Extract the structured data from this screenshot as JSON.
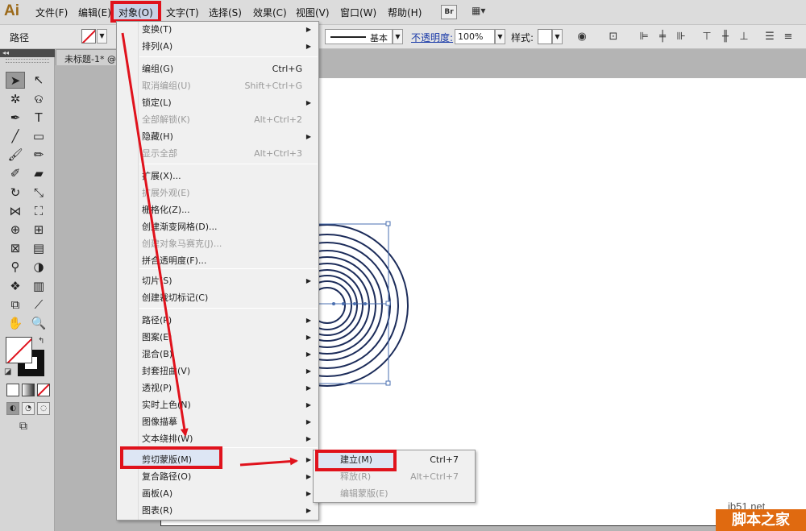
{
  "app": {
    "logo": "Ai"
  },
  "menubar": {
    "items": [
      "文件(F)",
      "编辑(E)",
      "对象(O)",
      "文字(T)",
      "选择(S)",
      "效果(C)",
      "视图(V)",
      "窗口(W)",
      "帮助(H)"
    ],
    "bridge_label": "Br",
    "arrange_icon": "▦▾"
  },
  "controlbar": {
    "selection_label": "路径",
    "stroke_profile": "基本",
    "opacity_label": "不透明度:",
    "opacity_value": "100%",
    "style_label": "样式:"
  },
  "document": {
    "tab_title": "未标题-1* @"
  },
  "object_menu": {
    "items": [
      {
        "label": "变换(T)",
        "submenu": true
      },
      {
        "label": "排列(A)",
        "submenu": true
      },
      {
        "label": "编组(G)",
        "shortcut": "Ctrl+G"
      },
      {
        "label": "取消编组(U)",
        "shortcut": "Shift+Ctrl+G",
        "disabled": true
      },
      {
        "label": "锁定(L)",
        "submenu": true
      },
      {
        "label": "全部解锁(K)",
        "shortcut": "Alt+Ctrl+2",
        "disabled": true
      },
      {
        "label": "隐藏(H)",
        "submenu": true
      },
      {
        "label": "显示全部",
        "shortcut": "Alt+Ctrl+3",
        "disabled": true
      },
      {
        "label": "扩展(X)..."
      },
      {
        "label": "扩展外观(E)",
        "disabled": true
      },
      {
        "label": "栅格化(Z)..."
      },
      {
        "label": "创建渐变网格(D)..."
      },
      {
        "label": "创建对象马赛克(J)...",
        "disabled": true
      },
      {
        "label": "拼合透明度(F)..."
      },
      {
        "label": "切片(S)",
        "submenu": true
      },
      {
        "label": "创建裁切标记(C)"
      },
      {
        "label": "路径(P)",
        "submenu": true
      },
      {
        "label": "图案(E)",
        "submenu": true
      },
      {
        "label": "混合(B)",
        "submenu": true
      },
      {
        "label": "封套扭曲(V)",
        "submenu": true
      },
      {
        "label": "透视(P)",
        "submenu": true
      },
      {
        "label": "实时上色(N)",
        "submenu": true
      },
      {
        "label": "图像描摹",
        "submenu": true
      },
      {
        "label": "文本绕排(W)",
        "submenu": true
      },
      {
        "label": "剪切蒙版(M)",
        "submenu": true,
        "highlighted": true
      },
      {
        "label": "复合路径(O)",
        "submenu": true
      },
      {
        "label": "画板(A)",
        "submenu": true
      },
      {
        "label": "图表(R)",
        "submenu": true
      }
    ]
  },
  "clip_submenu": {
    "items": [
      {
        "label": "建立(M)",
        "shortcut": "Ctrl+7",
        "highlighted": true
      },
      {
        "label": "释放(R)",
        "shortcut": "Alt+Ctrl+7",
        "disabled": true
      },
      {
        "label": "编辑蒙版(E)",
        "disabled": true
      }
    ]
  },
  "icons": {
    "submenu_arrow": "▶",
    "dropdown": "▼"
  },
  "colors": {
    "annotation_red": "#e0121c",
    "selection_blue": "#4a6fb0"
  },
  "watermark": {
    "url": "jb51.net",
    "brand": "脚本之家"
  }
}
